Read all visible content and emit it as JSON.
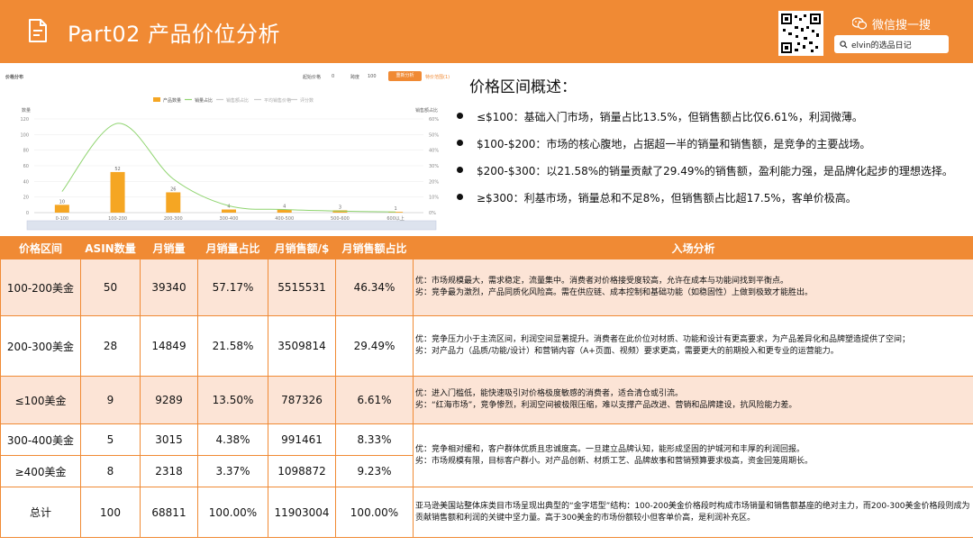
{
  "header": {
    "title": "Part02 产品价位分析",
    "wechat_label": "微信搜一搜",
    "search_text": "elvin的选品日记",
    "icons": [
      "document-icon",
      "qr-code-icon",
      "wechat-icon",
      "search-icon"
    ],
    "accent_color": "#f08a34"
  },
  "chart_panel": {
    "title": "价格分布",
    "start_label": "起始价格",
    "start_value": "0",
    "step_label": "跨度",
    "step_value": "100",
    "button_label": "重新分析",
    "link_label": "特价范围(1)"
  },
  "chart_data": {
    "type": "bar",
    "categories": [
      "0-100",
      "100-200",
      "200-300",
      "300-400",
      "400-500",
      "500-600",
      "600以上"
    ],
    "series": [
      {
        "name": "产品数量",
        "values": [
          10,
          52,
          26,
          4,
          4,
          3,
          1
        ],
        "color": "#f5a623"
      },
      {
        "name": "销量占比",
        "values": [
          13.5,
          57.17,
          21.58,
          4.38,
          2.0,
          1.0,
          0.4
        ],
        "color": "#8fd46f"
      }
    ],
    "legend": [
      "产品数量",
      "销量占比",
      "销售额占比",
      "平均销售价格",
      "评分数"
    ],
    "ylabel_left": "数量",
    "ylabel_right": "销售额占比",
    "ylim_left": [
      0,
      120
    ],
    "ylim_right": [
      0,
      60
    ],
    "y_ticks_left": [
      "0",
      "20",
      "40",
      "60",
      "80",
      "100",
      "120"
    ],
    "y_ticks_right": [
      "0%",
      "10%",
      "20%",
      "30%",
      "40%",
      "50%",
      "60%"
    ],
    "legend_position": "top"
  },
  "overview": {
    "title": "价格区间概述：",
    "items": [
      "≤$100：基础入门市场，销量占比13.5%，但销售额占比仅6.61%，利润微薄。",
      "$100-$200：市场的核心腹地，占据超一半的销量和销售额，是竞争的主要战场。",
      "$200-$300：以21.58%的销量贡献了29.49%的销售额，盈利能力强，是品牌化起步的理想选择。",
      "≥$300：利基市场，销量总和不足8%，但销售额占比超17.5%，客单价极高。"
    ]
  },
  "table": {
    "headers": [
      "价格区间",
      "ASIN数量",
      "月销量",
      "月销量占比",
      "月销售额/$",
      "月销售额占比",
      "入场分析"
    ],
    "rows": [
      {
        "range": "100-200美金",
        "asin": "50",
        "sales": "39340",
        "sales_pct": "57.17%",
        "revenue": "5515531",
        "revenue_pct": "46.34%",
        "analysis": [
          "优：市场规模最大，需求稳定，流量集中。消费者对价格接受度较高，允许在成本与功能间找到平衡点。",
          "劣：竞争最为激烈，产品同质化风险高。需在供应链、成本控制和基础功能（如稳固性）上做到极致才能胜出。"
        ]
      },
      {
        "range": "200-300美金",
        "asin": "28",
        "sales": "14849",
        "sales_pct": "21.58%",
        "revenue": "3509814",
        "revenue_pct": "29.49%",
        "analysis": [
          "优：竞争压力小于主流区间，利润空间显著提升。消费者在此价位对材质、功能和设计有更高要求，为产品差异化和品牌塑造提供了空间；",
          "劣：对产品力（品质/功能/设计）和营销内容（A+页面、视频）要求更高，需要更大的前期投入和更专业的运营能力。"
        ]
      },
      {
        "range": "≤100美金",
        "asin": "9",
        "sales": "9289",
        "sales_pct": "13.50%",
        "revenue": "787326",
        "revenue_pct": "6.61%",
        "analysis": [
          "优：进入门槛低，能快速吸引对价格极度敏感的消费者，适合清仓或引流。",
          "劣：“红海市场”，竞争惨烈，利润空间被极限压缩，难以支撑产品改进、营销和品牌建设，抗风险能力差。"
        ]
      },
      {
        "range": "300-400美金",
        "asin": "5",
        "sales": "3015",
        "sales_pct": "4.38%",
        "revenue": "991461",
        "revenue_pct": "8.33%"
      },
      {
        "range": "≥400美金",
        "asin": "8",
        "sales": "2318",
        "sales_pct": "3.37%",
        "revenue": "1098872",
        "revenue_pct": "9.23%"
      },
      {
        "range": "总计",
        "asin": "100",
        "sales": "68811",
        "sales_pct": "100.00%",
        "revenue": "11903004",
        "revenue_pct": "100.00%",
        "analysis": [
          "亚马逊美国站整体床类目市场呈现出典型的“金字塔型”结构：100-200美金价格段时构成市场销量和销售额基座的绝对主力，而200-300美金价格段则成为贡献销售额和利润的关键中坚力量。高于300美金的市场份额较小但客单价高，是利润补充区。"
        ]
      }
    ],
    "merged_analysis_300_plus": [
      "优：竞争相对缓和，客户群体优质且忠诚度高。一旦建立品牌认知，能形成坚固的护城河和丰厚的利润回报。",
      "劣：市场规模有限，目标客户群小。对产品创新、材质工艺、品牌故事和营销预算要求极高，资金回笼周期长。"
    ]
  }
}
